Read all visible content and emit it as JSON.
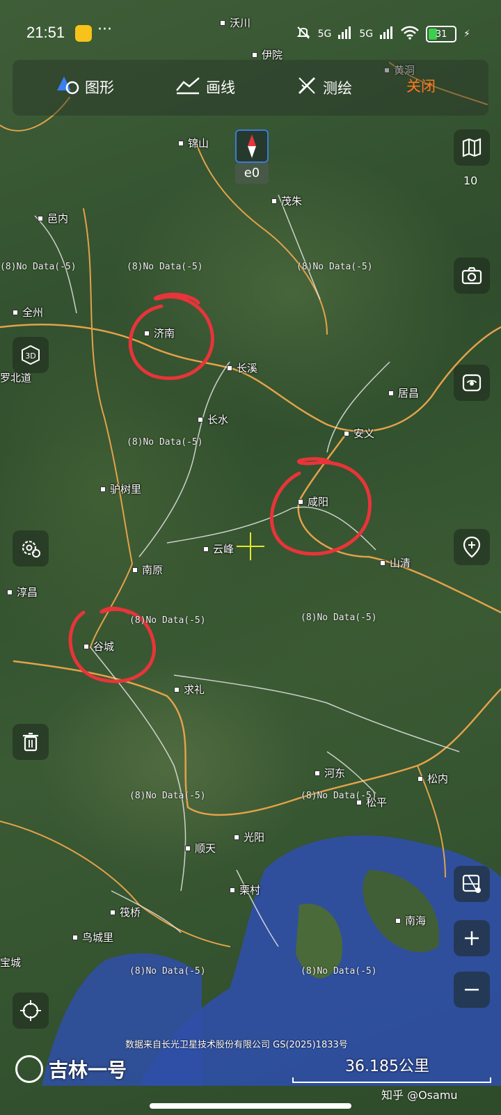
{
  "status_bar": {
    "time": "21:51",
    "more": "···",
    "signal1": "5G",
    "signal2": "5G",
    "battery": "31"
  },
  "toolbar": {
    "shape_label": "图形",
    "line_label": "画线",
    "survey_label": "测绘",
    "close_label": "关闭"
  },
  "compass": {
    "label": "e0"
  },
  "side_panel": {
    "layers_count": "10"
  },
  "places": [
    {
      "name": "沃川"
    },
    {
      "name": "伊院"
    },
    {
      "name": "黄洞"
    },
    {
      "name": "锦山"
    },
    {
      "name": "茂朱"
    },
    {
      "name": "邑内"
    },
    {
      "name": "全州"
    },
    {
      "name": "济南"
    },
    {
      "name": "长溪"
    },
    {
      "name": "居昌"
    },
    {
      "name": "罗北道"
    },
    {
      "name": "长水"
    },
    {
      "name": "安义"
    },
    {
      "name": "驴树里"
    },
    {
      "name": "咸阳"
    },
    {
      "name": "云峰"
    },
    {
      "name": "山清"
    },
    {
      "name": "南原"
    },
    {
      "name": "淳昌"
    },
    {
      "name": "谷城"
    },
    {
      "name": "求礼"
    },
    {
      "name": "河东"
    },
    {
      "name": "松内"
    },
    {
      "name": "松平"
    },
    {
      "name": "光阳"
    },
    {
      "name": "顺天"
    },
    {
      "name": "栗村"
    },
    {
      "name": "筏桥"
    },
    {
      "name": "南海"
    },
    {
      "name": "鸟城里"
    },
    {
      "name": "宝城"
    }
  ],
  "nodata_label": "(8)No Data(-5)",
  "footer": {
    "attribution": "数据来自长光卫星技术股份有限公司 GS(2025)1833号",
    "brand": "吉林一号",
    "scale": "36.185公里",
    "watermark": "知乎 @Osamu"
  },
  "colors": {
    "close_accent": "#ff7a1a",
    "annotation_circle": "#e8343a",
    "compass_border": "#3d7bd8",
    "road": "#e3a24a",
    "water": "#2f4fa8"
  }
}
